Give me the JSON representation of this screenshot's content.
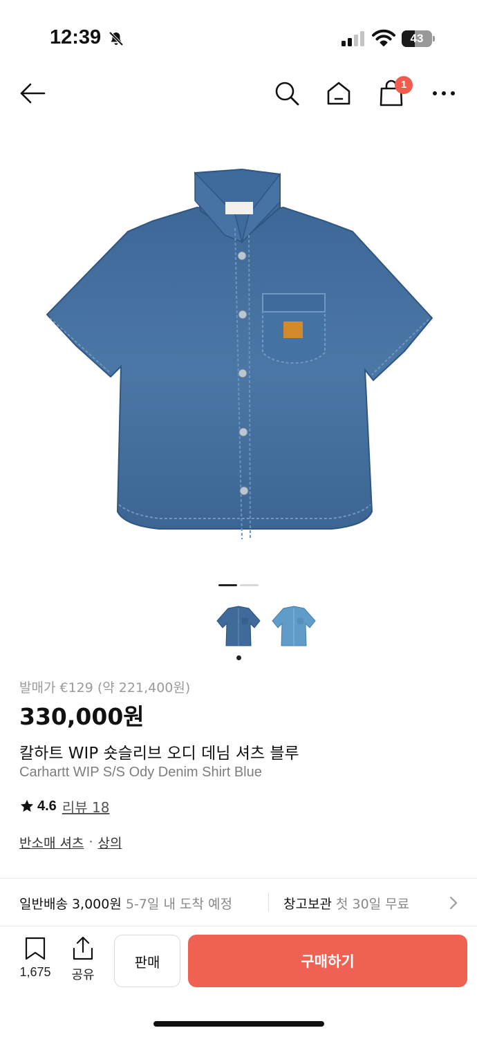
{
  "status": {
    "time": "12:39",
    "battery": "43",
    "battery_level": 0.43
  },
  "nav": {
    "cart_count": "1"
  },
  "gallery": {
    "current_index": 1,
    "total": 2
  },
  "product": {
    "release_price": "발매가 €129 (약 221,400원)",
    "price": "330,000원",
    "name_ko": "칼하트 WIP 숏슬리브 오디 데님 셔츠 블루",
    "name_en": "Carhartt WIP S/S Ody Denim Shirt Blue",
    "rating": "4.6",
    "review_link": "리뷰 18",
    "categories": [
      "반소매 셔츠",
      "상의"
    ],
    "category_separator": "·"
  },
  "delivery": {
    "label": "일반배송 3,000원",
    "eta": "5-7일 내 도착 예정",
    "storage_label": "창고보관",
    "storage_note": "첫 30일 무료"
  },
  "bottom": {
    "bookmark_count": "1,675",
    "share_label": "공유",
    "sell_label": "판매",
    "buy_label": "구매하기"
  },
  "colors": {
    "accent": "#ef6253",
    "badge": "#ef5b4c",
    "denim_dark": "#3f6a9a",
    "denim_light": "#5f9cc8"
  }
}
